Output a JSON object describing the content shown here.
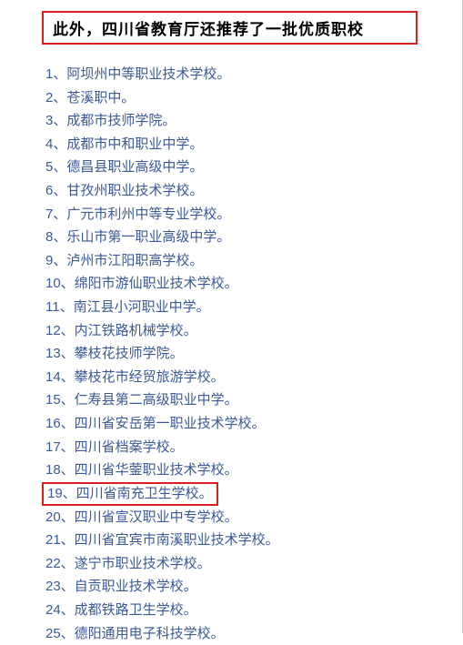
{
  "title": "此外，四川省教育厅还推荐了一批优质职校",
  "items": [
    "1、阿坝州中等职业技术学校。",
    "2、苍溪职中。",
    "3、成都市技师学院。",
    "4、成都市中和职业中学。",
    "5、德昌县职业高级中学。",
    "6、甘孜州职业技术学校。",
    "7、广元市利州中等专业学校。",
    "8、乐山市第一职业高级中学。",
    "9、泸州市江阳职高学校。",
    "10、绵阳市游仙职业技术学校。",
    "11、南江县小河职业中学。",
    "12、内江铁路机械学校。",
    "13、攀枝花技师学院。",
    "14、攀枝花市经贸旅游学校。",
    "15、仁寿县第二高级职业中学。",
    "16、四川省安岳第一职业技术学校。",
    "17、四川省档案学校。",
    "18、四川省华蓥职业技术学校。",
    "19、四川省南充卫生学校。",
    "20、四川省宣汉职业中专学校。",
    "21、四川省宜宾市南溪职业技术学校。",
    "22、遂宁市职业技术学校。",
    "23、自贡职业技术学校。",
    "24、成都铁路卫生学校。",
    "25、德阳通用电子科技学校。"
  ],
  "highlight_index": 18
}
